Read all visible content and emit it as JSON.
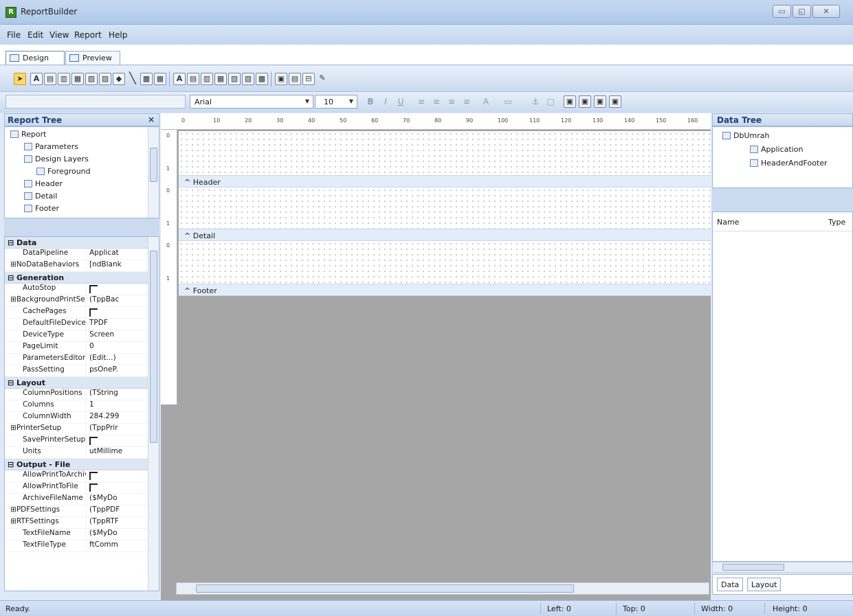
{
  "window": {
    "title": "ReportBuilder",
    "icon_letter": "R",
    "minimize": "▭",
    "maximize": "◱",
    "close": "✕"
  },
  "menu": [
    "File",
    "Edit",
    "View",
    "Report",
    "Help"
  ],
  "tabs": [
    {
      "label": "Design",
      "active": true
    },
    {
      "label": "Preview",
      "active": false
    }
  ],
  "toolbar": {
    "components": [
      "select-tool",
      "label-tool",
      "memo-tool",
      "richtext-tool",
      "systemvariable-tool",
      "variable-tool",
      "image-tool",
      "shape-icon",
      "line-tool",
      "barcode-tool",
      "chart-tool",
      "dbtext-tool",
      "dbmemo-tool",
      "dbrichtext-tool",
      "dbcalc-tool",
      "dbimage-tool",
      "dbbarcode-tool",
      "region-tool",
      "subreport-tool",
      "pagebreak-tool",
      "crossTab-tool"
    ],
    "font_name": "Arial",
    "font_size": "10",
    "format_buttons": [
      "B",
      "I",
      "U"
    ]
  },
  "report_tree": {
    "title": "Report Tree",
    "close": "×",
    "nodes": [
      {
        "label": "Report",
        "level": 0
      },
      {
        "label": "Parameters",
        "level": 1
      },
      {
        "label": "Design Layers",
        "level": 1
      },
      {
        "label": "Foreground",
        "level": 2
      },
      {
        "label": "Header",
        "level": 1
      },
      {
        "label": "Detail",
        "level": 1
      },
      {
        "label": "Footer",
        "level": 1
      }
    ]
  },
  "properties": {
    "categories": [
      {
        "name": "Data",
        "rows": [
          {
            "name": "DataPipeline",
            "value": "Applicat",
            "expand": false
          },
          {
            "name": "NoDataBehaviors",
            "value": "[ndBlank",
            "expand": true
          }
        ]
      },
      {
        "name": "Generation",
        "rows": [
          {
            "name": "AutoStop",
            "value": "",
            "checkbox": true
          },
          {
            "name": "BackgroundPrintSe",
            "value": "(TppBac",
            "expand": true
          },
          {
            "name": "CachePages",
            "value": "",
            "checkbox": true
          },
          {
            "name": "DefaultFileDevice",
            "value": "TPDF"
          },
          {
            "name": "DeviceType",
            "value": "Screen"
          },
          {
            "name": "PageLimit",
            "value": "0"
          },
          {
            "name": "ParametersEditor",
            "value": "(Edit...)"
          },
          {
            "name": "PassSetting",
            "value": "psOneP."
          }
        ]
      },
      {
        "name": "Layout",
        "rows": [
          {
            "name": "ColumnPositions",
            "value": "(TString"
          },
          {
            "name": "Columns",
            "value": "1"
          },
          {
            "name": "ColumnWidth",
            "value": "284.299"
          },
          {
            "name": "PrinterSetup",
            "value": "(TppPrir",
            "expand": true
          },
          {
            "name": "SavePrinterSetup",
            "value": "",
            "checkbox": true
          },
          {
            "name": "Units",
            "value": "utMillime"
          }
        ]
      },
      {
        "name": "Output - File",
        "rows": [
          {
            "name": "AllowPrintToArchiv",
            "value": "",
            "checkbox": true
          },
          {
            "name": "AllowPrintToFile",
            "value": "",
            "checkbox": true
          },
          {
            "name": "ArchiveFileName",
            "value": "($MyDo"
          },
          {
            "name": "PDFSettings",
            "value": "(TppPDF",
            "expand": true
          },
          {
            "name": "RTFSettings",
            "value": "(TppRTF",
            "expand": true
          },
          {
            "name": "TextFileName",
            "value": "($MyDo"
          },
          {
            "name": "TextFileType",
            "value": "ftComm"
          }
        ]
      }
    ]
  },
  "ruler": {
    "marks": [
      "0",
      "10",
      "20",
      "30",
      "40",
      "50",
      "60",
      "70",
      "80",
      "90",
      "100",
      "110",
      "120",
      "130",
      "140",
      "150",
      "160"
    ],
    "vertical": [
      "0",
      "1",
      "0",
      "1",
      "0",
      "1"
    ]
  },
  "bands": [
    "Header",
    "Detail",
    "Footer"
  ],
  "data_tree": {
    "title": "Data Tree",
    "database": "DbUmrah",
    "tables": [
      "Application",
      "HeaderAndFooter"
    ],
    "columns": {
      "name": "Name",
      "type": "Type"
    },
    "tabs": [
      "Data",
      "Layout"
    ]
  },
  "status": {
    "message": "Ready.",
    "left": "Left: 0",
    "top": "Top: 0",
    "width": "Width: 0",
    "height": "Height: 0"
  },
  "colors": {
    "chrome": "#dfe8f6",
    "band_label": "#e3edf9",
    "design_bg": "#a6a6a6",
    "accent": "#1f3f6f"
  }
}
